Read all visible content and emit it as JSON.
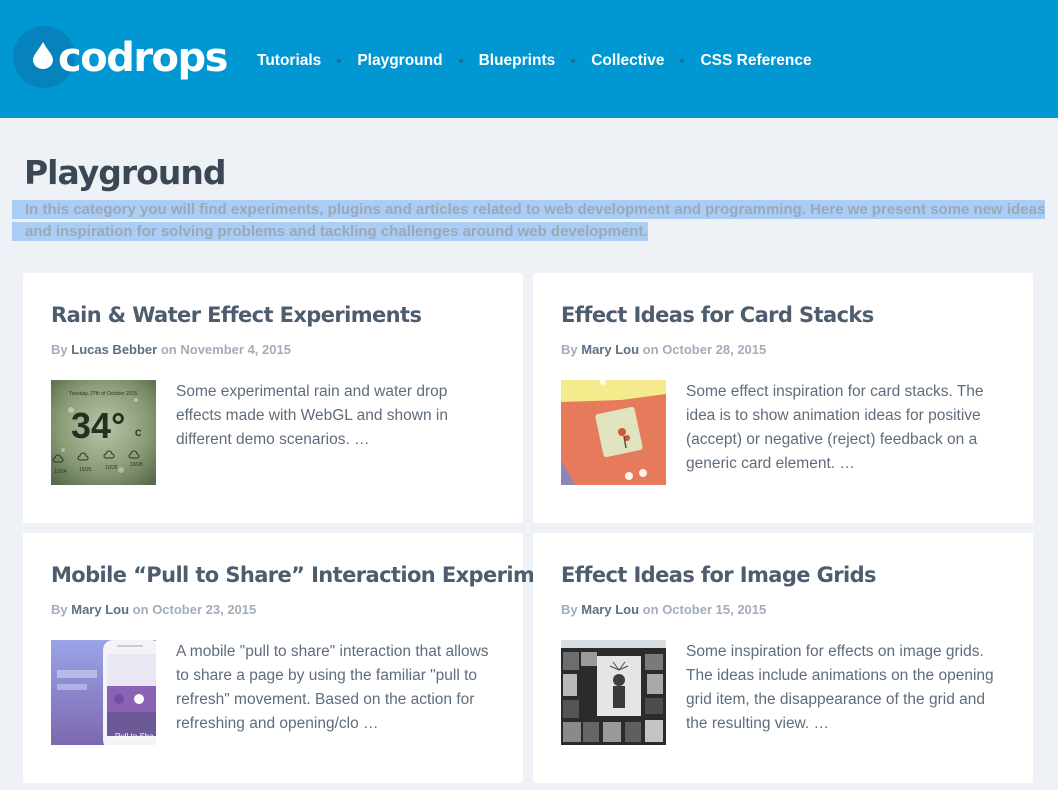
{
  "header": {
    "logo_text": "codrops",
    "nav": [
      "Tutorials",
      "Playground",
      "Blueprints",
      "Collective",
      "CSS Reference"
    ]
  },
  "page": {
    "title": "Playground",
    "intro": "In this category you will find experiments, plugins and articles related to web development and programming. Here we present some new ideas and inspiration for solving problems and tackling challenges around web development."
  },
  "articles": [
    {
      "title": "Rain & Water Effect Experiments",
      "by": "By",
      "author": "Lucas Bebber",
      "on": "on",
      "date": "November 4, 2015",
      "excerpt": "Some experimental rain and water drop effects made with WebGL and shown in different demo scenarios. …",
      "thumb": {
        "date_line": "Tuesday, 27th of October 2015",
        "temperature": "34°",
        "unit": "C",
        "days": [
          "10/24",
          "10/25",
          "10/26",
          "10/28"
        ]
      }
    },
    {
      "title": "Effect Ideas for Card Stacks",
      "by": "By",
      "author": "Mary Lou",
      "on": "on",
      "date": "October 28, 2015",
      "excerpt": "Some effect inspiration for card stacks. The idea is to show animation ideas for positive (accept) or negative (reject) feedback on a generic card element. …"
    },
    {
      "title": "Mobile “Pull to Share” Interaction Experiment",
      "by": "By",
      "author": "Mary Lou",
      "on": "on",
      "date": "October 23, 2015",
      "excerpt": "A mobile \"pull to share\" interaction that allows to share a page by using the familiar \"pull to refresh\" movement. Based on the action for refreshing and opening/clo …",
      "thumb": {
        "caption": "Pull to Sha"
      }
    },
    {
      "title": "Effect Ideas for Image Grids",
      "by": "By",
      "author": "Mary Lou",
      "on": "on",
      "date": "October 15, 2015",
      "excerpt": "Some inspiration for effects on image grids. The ideas include animations on the opening grid item, the disappearance of the grid and the resulting view. …"
    }
  ],
  "colors": {
    "header_bg": "#0097d2",
    "page_bg": "#eef2f7",
    "selection": "#a9cdf5",
    "title_text": "#4d5d6e",
    "author_text": "#5b7085"
  }
}
